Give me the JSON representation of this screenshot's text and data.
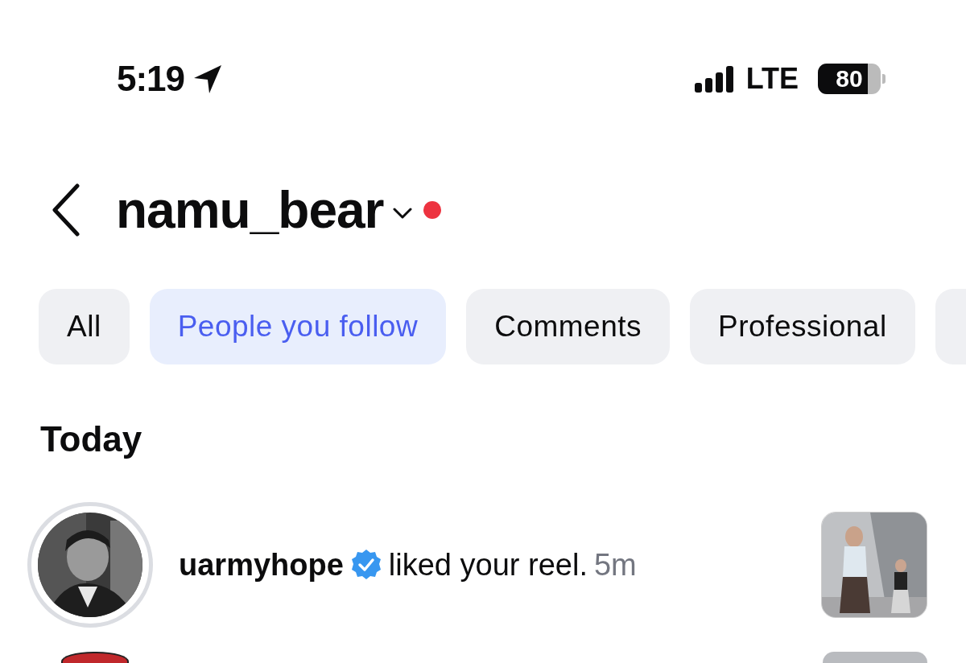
{
  "status_bar": {
    "time": "5:19",
    "network": "LTE",
    "battery": "80"
  },
  "header": {
    "title": "namu_bear",
    "unread": true
  },
  "filters": [
    {
      "kind": "chip",
      "label": "All",
      "selected": false
    },
    {
      "kind": "chip",
      "label": "People you follow",
      "selected": true
    },
    {
      "kind": "chip",
      "label": "Comments",
      "selected": false
    },
    {
      "kind": "chip",
      "label": "Professional",
      "selected": false
    },
    {
      "kind": "cut"
    }
  ],
  "section": "Today",
  "notifications": [
    {
      "kind": "full",
      "username": "uarmyhope",
      "verified": true,
      "text": "liked your reel.",
      "time": "5m"
    },
    {
      "kind": "partial"
    }
  ]
}
